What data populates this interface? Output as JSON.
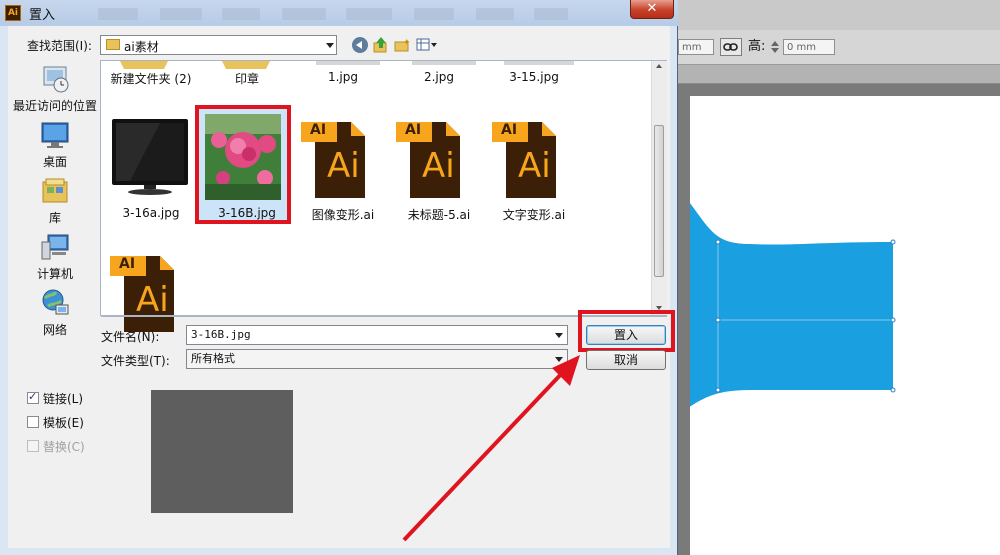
{
  "dialog": {
    "title": "置入",
    "close_glyph": "✕",
    "look_in_label": "查找范围(I):",
    "look_in_value": "ai素材",
    "places": [
      {
        "label": "最近访问的位置",
        "icon": "recent-places-icon"
      },
      {
        "label": "桌面",
        "icon": "desktop-icon"
      },
      {
        "label": "库",
        "icon": "libraries-icon"
      },
      {
        "label": "计算机",
        "icon": "computer-icon"
      },
      {
        "label": "网络",
        "icon": "network-icon"
      }
    ],
    "files_row1": [
      "新建文件夹 (2)",
      "印章",
      "1.jpg",
      "2.jpg",
      "3-15.jpg"
    ],
    "files_row2": [
      "3-16a.jpg",
      "3-16B.jpg",
      "图像变形.ai",
      "未标题-5.ai",
      "文字变形.ai"
    ],
    "ai_icon_text": "Ai",
    "ai_tab_text": "AI",
    "filename_label": "文件名(N):",
    "filename_value": "3-16B.jpg",
    "filetype_label": "文件类型(T):",
    "filetype_value": "所有格式",
    "place_button": "置入",
    "cancel_button": "取消",
    "options": [
      {
        "label": "链接(L)",
        "checked": true,
        "enabled": true
      },
      {
        "label": "模板(E)",
        "checked": false,
        "enabled": true
      },
      {
        "label": "替换(C)",
        "checked": false,
        "enabled": false
      }
    ]
  },
  "app": {
    "field1_value": "mm",
    "height_label": "高:",
    "height_value": "0 mm",
    "ai_logo_text": "Ai",
    "shape_color": "#1aa0e0"
  },
  "colors": {
    "highlight_red": "#e0141e",
    "selection_blue": "#cce4f7"
  }
}
